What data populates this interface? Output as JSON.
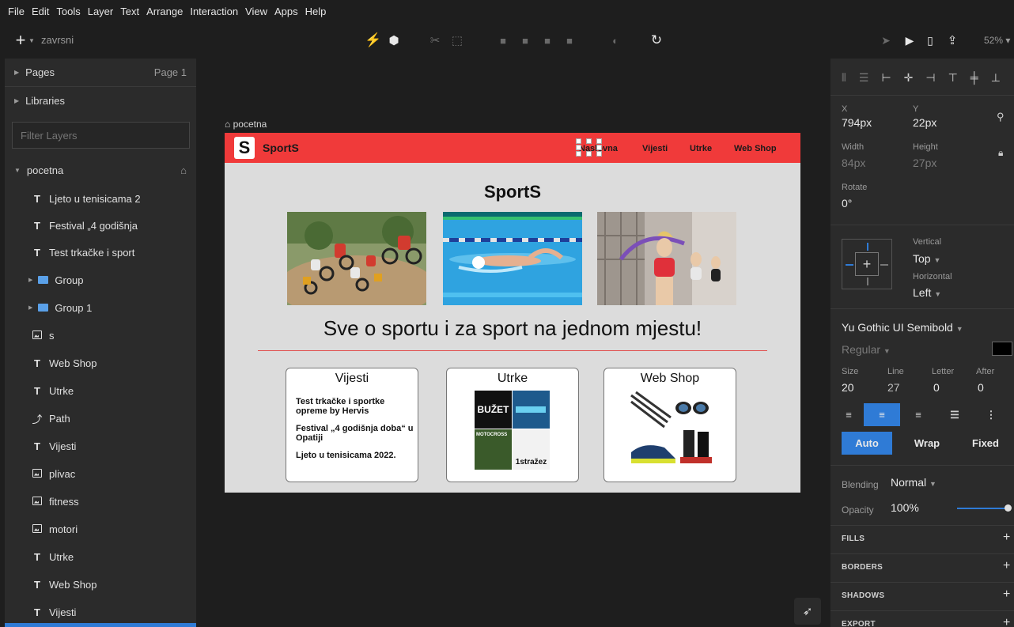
{
  "menu": [
    "File",
    "Edit",
    "Tools",
    "Layer",
    "Text",
    "Arrange",
    "Interaction",
    "View",
    "Apps",
    "Help"
  ],
  "toolbar": {
    "document_title": "zavrsni",
    "zoom": "52%"
  },
  "left_panel": {
    "pages_label": "Pages",
    "current_page": "Page 1",
    "libraries_label": "Libraries",
    "filter_placeholder": "Filter Layers",
    "artboard_name": "pocetna",
    "layers": [
      {
        "name": "Ljeto u tenisicama 2",
        "type": "text"
      },
      {
        "name": "Festival „4 godišnja",
        "type": "text"
      },
      {
        "name": "Test trkačke i sport",
        "type": "text"
      },
      {
        "name": "Group",
        "type": "group"
      },
      {
        "name": "Group 1",
        "type": "group"
      },
      {
        "name": "s",
        "type": "image"
      },
      {
        "name": "Web Shop",
        "type": "text"
      },
      {
        "name": "Utrke",
        "type": "text"
      },
      {
        "name": "Path",
        "type": "path"
      },
      {
        "name": "Vijesti",
        "type": "text"
      },
      {
        "name": "plivac",
        "type": "image"
      },
      {
        "name": "fitness",
        "type": "image"
      },
      {
        "name": "motori",
        "type": "image"
      },
      {
        "name": "Utrke",
        "type": "text"
      },
      {
        "name": "Web Shop",
        "type": "text"
      },
      {
        "name": "Vijesti",
        "type": "text"
      }
    ]
  },
  "canvas": {
    "artboard_label": "pocetna",
    "logo_letter": "S",
    "logo_text": "SportS",
    "nav": [
      "Naslovna",
      "Vijesti",
      "Utrke",
      "Web Shop"
    ],
    "title": "SportS",
    "tagline": "Sve o sportu i za sport na jednom mjestu!",
    "cards": [
      {
        "title": "Vijesti",
        "items": [
          "Test trkačke i sportke opreme by Hervis",
          "Festival „4 godišnja doba“ u Opatiji",
          "Ljeto u tenisicama 2022."
        ]
      },
      {
        "title": "Utrke",
        "logos": [
          "BUŽET",
          "MOTOCROSS",
          "1stražez"
        ]
      },
      {
        "title": "Web Shop"
      }
    ]
  },
  "inspector": {
    "x_label": "X",
    "x_value": "794px",
    "y_label": "Y",
    "y_value": "22px",
    "width_label": "Width",
    "width_value": "84px",
    "height_label": "Height",
    "height_value": "27px",
    "rotate_label": "Rotate",
    "rotate_value": "0°",
    "vertical_label": "Vertical",
    "vertical_value": "Top",
    "horizontal_label": "Horizontal",
    "horizontal_value": "Left",
    "font_family": "Yu Gothic UI Semibold",
    "font_weight": "Regular",
    "size_label": "Size",
    "size_value": "20",
    "line_label": "Line",
    "line_value": "27",
    "letter_label": "Letter",
    "letter_value": "0",
    "after_label": "After",
    "after_value": "0",
    "sizing": [
      "Auto",
      "Wrap",
      "Fixed"
    ],
    "blending_label": "Blending",
    "blending_value": "Normal",
    "opacity_label": "Opacity",
    "opacity_value": "100%",
    "opacity_fraction": 1.0,
    "sections": [
      "FILLS",
      "BORDERS",
      "SHADOWS",
      "EXPORT"
    ]
  },
  "colors": {
    "brand_red": "#f03a3a",
    "selection_blue": "#2f7bd6",
    "panel": "#2b2b2b"
  }
}
